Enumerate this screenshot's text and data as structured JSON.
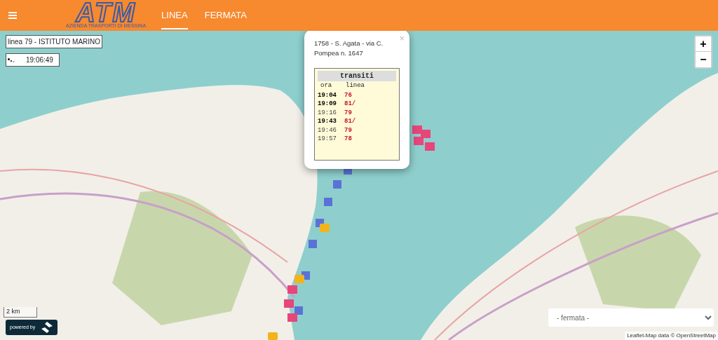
{
  "navbar": {
    "logo": {
      "mark": "ATM",
      "subtitle": "AZIENDA TRASPORTI DI MESSINA"
    },
    "tabs": [
      {
        "label": "LINEA",
        "selected": true
      },
      {
        "label": "FERMATA",
        "selected": false
      }
    ]
  },
  "map": {
    "line_label": "linea 79 - ISTITUTO MARINO",
    "clock": "19:06:49",
    "popup": {
      "close": "×",
      "title": "1758 - S. Agata - via C. Pompea n. 1647",
      "table": {
        "title": "transiti",
        "columns": [
          "ora",
          "linea"
        ],
        "rows": [
          {
            "time": "19:04",
            "line": "76",
            "bold": true
          },
          {
            "time": "19:09",
            "line": "81/",
            "bold": true
          },
          {
            "time": "19:16",
            "line": "79",
            "bold": false
          },
          {
            "time": "19:43",
            "line": "81/",
            "bold": true
          },
          {
            "time": "19:46",
            "line": "79",
            "bold": false
          },
          {
            "time": "19:57",
            "line": "78",
            "bold": false
          }
        ]
      }
    },
    "zoom": [
      "+",
      "−"
    ],
    "scale": "2 km",
    "powered_by": "powered by",
    "stop_select": {
      "placeholder": "- fermata -"
    },
    "attribution": {
      "link": "Leaflet",
      "text": "-Map data © ",
      "source": "OpenStreetMap"
    }
  }
}
